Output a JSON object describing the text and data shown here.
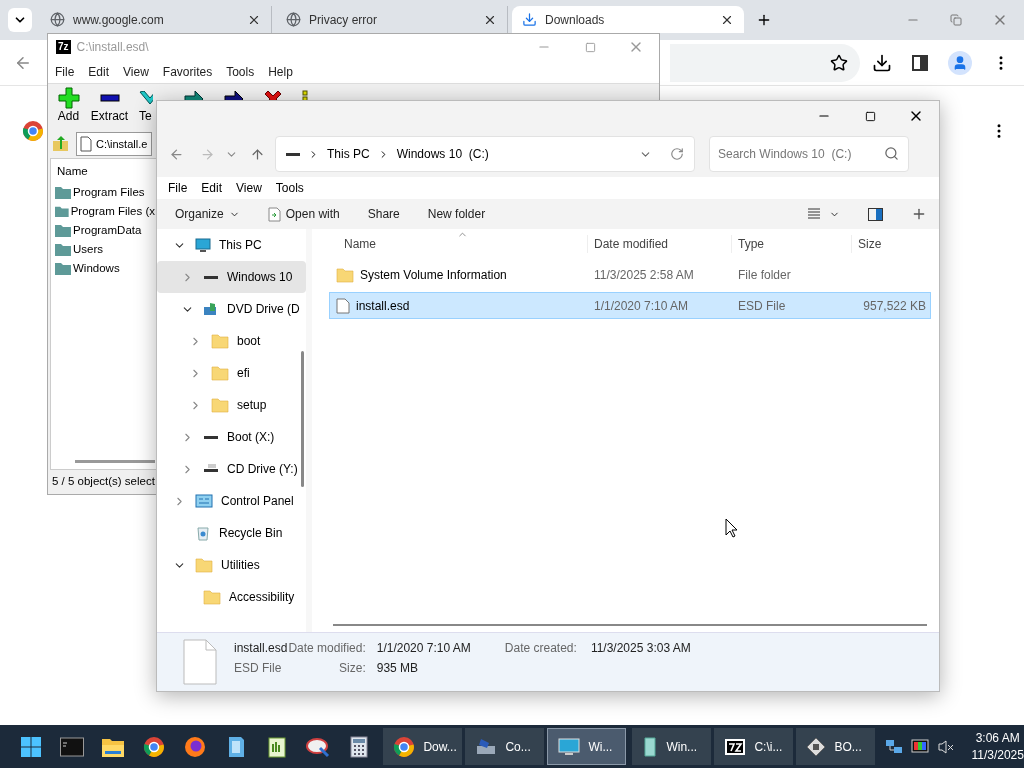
{
  "browser": {
    "tabs": [
      {
        "title": "www.google.com",
        "kind": "web",
        "selected": false
      },
      {
        "title": "Privacy error",
        "kind": "web",
        "selected": false
      },
      {
        "title": "Downloads",
        "kind": "download",
        "selected": true
      }
    ]
  },
  "sevenzip": {
    "logo": "7z",
    "title": "C:\\install.esd\\",
    "menu": [
      "File",
      "Edit",
      "View",
      "Favorites",
      "Tools",
      "Help"
    ],
    "toolbar": [
      {
        "label": "Add",
        "kind": "add"
      },
      {
        "label": "Extract",
        "kind": "extract"
      },
      {
        "label": "Te",
        "kind": "test"
      },
      {
        "kind": "copy"
      },
      {
        "kind": "move"
      },
      {
        "kind": "delete"
      },
      {
        "kind": "info"
      }
    ],
    "path": "C:\\install.e",
    "column": "Name",
    "items": [
      "Program Files",
      "Program Files (x",
      "ProgramData",
      "Users",
      "Windows"
    ],
    "status": "5 / 5 object(s) select"
  },
  "explorer": {
    "breadcrumb": [
      "This PC",
      "Windows 10  (C:)"
    ],
    "search_placeholder": "Search Windows 10  (C:)",
    "menu": [
      "File",
      "Edit",
      "View",
      "Tools"
    ],
    "commands": [
      {
        "label": "Organize",
        "kind": "dropdown"
      },
      {
        "label": "Open with",
        "kind": "open"
      },
      {
        "label": "Share",
        "kind": "plain"
      },
      {
        "label": "New folder",
        "kind": "plain"
      }
    ],
    "nav": [
      {
        "label": "This PC",
        "kind": "pc",
        "expandable": true,
        "expanded": true,
        "selected": false,
        "children": [
          {
            "label": "Windows 10",
            "kind": "drive",
            "expandable": true,
            "expanded": false,
            "selected": true
          },
          {
            "label": "DVD Drive (D",
            "kind": "dvd",
            "expandable": true,
            "expanded": true,
            "selected": false,
            "children": [
              {
                "label": "boot",
                "kind": "folder",
                "expandable": true,
                "expanded": false,
                "selected": false
              },
              {
                "label": "efi",
                "kind": "folder",
                "expandable": true,
                "expanded": false,
                "selected": false
              },
              {
                "label": "setup",
                "kind": "folder",
                "expandable": true,
                "expanded": false,
                "selected": false
              }
            ]
          },
          {
            "label": "Boot (X:)",
            "kind": "drive",
            "expandable": true,
            "expanded": false,
            "selected": false
          },
          {
            "label": "CD Drive (Y:)",
            "kind": "cd",
            "expandable": true,
            "expanded": false,
            "selected": false
          }
        ]
      },
      {
        "label": "Control Panel",
        "kind": "control",
        "expandable": true,
        "expanded": false,
        "selected": false
      },
      {
        "label": "Recycle Bin",
        "kind": "bin",
        "expandable": false,
        "selected": false
      },
      {
        "label": "Utilities",
        "kind": "folder",
        "expandable": true,
        "expanded": true,
        "selected": false,
        "children": [
          {
            "label": "Accessibility",
            "kind": "folder",
            "expandable": false,
            "selected": false
          }
        ]
      }
    ],
    "columns": [
      "Name",
      "Date modified",
      "Type",
      "Size"
    ],
    "rows": [
      {
        "name": "System Volume Information",
        "date": "11/3/2025 2:58 AM",
        "type": "File folder",
        "kind": "folder",
        "selected": false
      },
      {
        "name": "install.esd",
        "date": "1/1/2020 7:10 AM",
        "type": "ESD File",
        "size": "957,522 KB",
        "kind": "file",
        "selected": true
      }
    ],
    "details": {
      "name": "install.esd",
      "type": "ESD File",
      "modified_label": "Date modified:",
      "modified": "1/1/2020 7:10 AM",
      "size_label": "Size:",
      "size": "935 MB",
      "created_label": "Date created:",
      "created": "11/3/2025 3:03 AM"
    }
  },
  "taskbar": {
    "pinned": [
      {
        "kind": "start"
      },
      {
        "kind": "terminal"
      },
      {
        "kind": "explorer"
      },
      {
        "kind": "chrome"
      },
      {
        "kind": "firefox"
      },
      {
        "kind": "notes"
      },
      {
        "kind": "editor"
      },
      {
        "kind": "paint"
      },
      {
        "kind": "calc"
      }
    ],
    "windows": [
      {
        "label": "Dow...",
        "kind": "chrome",
        "selected": false
      },
      {
        "label": "Co...",
        "kind": "setup",
        "selected": false
      },
      {
        "label": "Wi...",
        "kind": "monitor",
        "selected": true
      },
      {
        "label": "Win...",
        "kind": "usb",
        "selected": false
      },
      {
        "label": "C:\\i...",
        "kind": "sevenzip",
        "selected": false
      },
      {
        "label": "BO...",
        "kind": "boot",
        "selected": false
      }
    ],
    "time": "3:06 AM",
    "date": "11/3/2025"
  }
}
